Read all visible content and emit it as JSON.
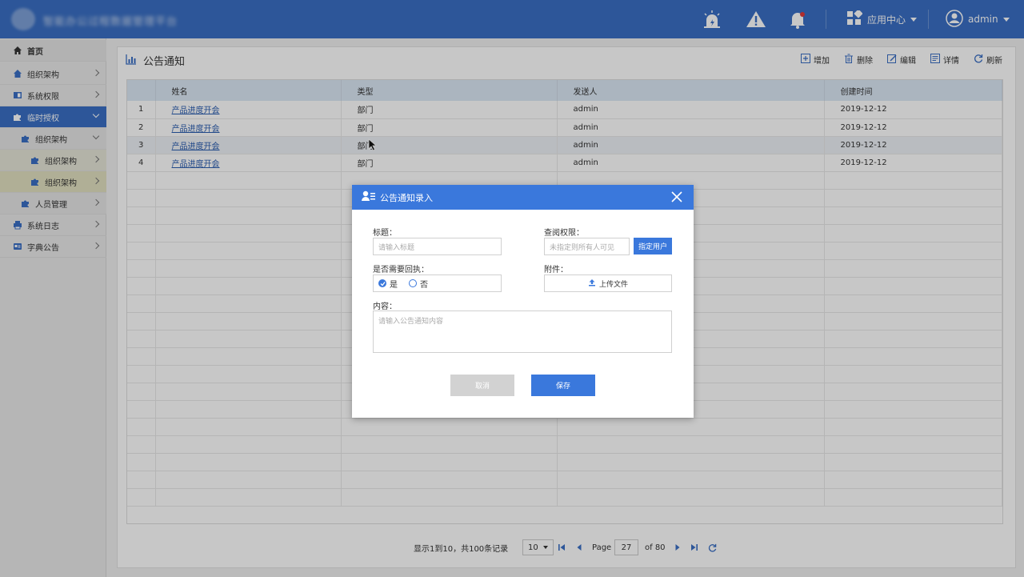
{
  "header": {
    "brand": "智能办公过程数据管理平台",
    "app_center": "应用中心",
    "user": "admin"
  },
  "sidebar": {
    "items": [
      {
        "label": "首页"
      },
      {
        "label": "组织架构"
      },
      {
        "label": "系统权限"
      },
      {
        "label": "临时授权"
      },
      {
        "label": "组织架构"
      },
      {
        "label": "组织架构"
      },
      {
        "label": "组织架构"
      },
      {
        "label": "人员管理"
      },
      {
        "label": "系统日志"
      },
      {
        "label": "字典公告"
      }
    ]
  },
  "page": {
    "title": "公告通知",
    "toolbar": {
      "add": "增加",
      "delete": "删除",
      "edit": "编辑",
      "detail": "详情",
      "refresh": "刷新"
    }
  },
  "table": {
    "columns": [
      "",
      "姓名",
      "类型",
      "发送人",
      "创建时间"
    ],
    "rows": [
      {
        "no": "1",
        "name": "产品进度开会",
        "type": "部门",
        "sender": "admin",
        "created": "2019-12-12"
      },
      {
        "no": "2",
        "name": "产品进度开会",
        "type": "部门",
        "sender": "admin",
        "created": "2019-12-12"
      },
      {
        "no": "3",
        "name": "产品进度开会",
        "type": "部门",
        "sender": "admin",
        "created": "2019-12-12"
      },
      {
        "no": "4",
        "name": "产品进度开会",
        "type": "部门",
        "sender": "admin",
        "created": "2019-12-12"
      }
    ]
  },
  "pager": {
    "summary": "显示1到10，共100条记录",
    "page_size": "10",
    "page_label": "Page",
    "current_page": "27",
    "of_label": "of 80"
  },
  "modal": {
    "title": "公告通知录入",
    "title_label": "标题：",
    "title_placeholder": "请输入标题",
    "perm_label": "查阅权限：",
    "perm_placeholder": "未指定则所有人可见",
    "assign_button": "指定用户",
    "receipt_label": "是否需要回执：",
    "receipt_yes": "是",
    "receipt_no": "否",
    "receipt_value": "是",
    "attach_label": "附件：",
    "upload_button": "上传文件",
    "content_label": "内容：",
    "content_placeholder": "请输入公告通知内容",
    "cancel_button": "取消",
    "save_button": "保存"
  },
  "colors": {
    "header_blue": "#3a6fc4",
    "modal_blue": "#3a78dc",
    "notify_dot": "#e03a3a"
  }
}
